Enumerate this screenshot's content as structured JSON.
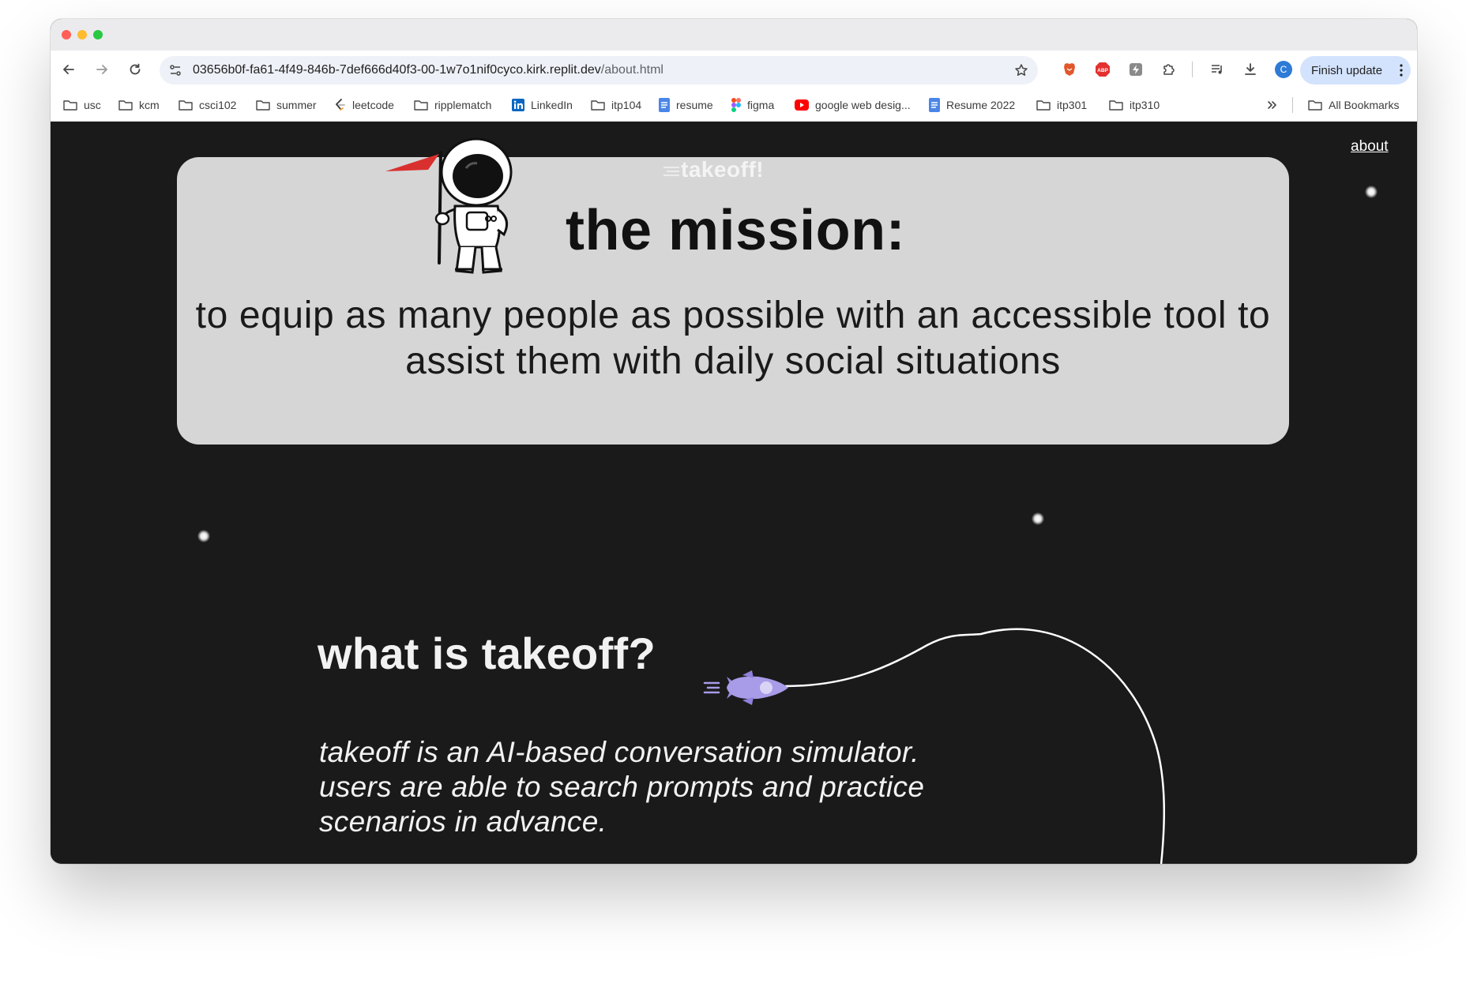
{
  "browser": {
    "url_host": "03656b0f-fa61-4f49-846b-7def666d40f3-00-1w7o1nif0cyco.kirk.replit.dev",
    "url_path": "/about.html",
    "finish_update_label": "Finish update",
    "profile_initial": "C",
    "bookmarks": [
      {
        "label": "usc",
        "icon": "folder-icon"
      },
      {
        "label": "kcm",
        "icon": "folder-icon"
      },
      {
        "label": "csci102",
        "icon": "folder-icon"
      },
      {
        "label": "summer",
        "icon": "folder-icon"
      },
      {
        "label": "leetcode",
        "icon": "leetcode-icon"
      },
      {
        "label": "ripplematch",
        "icon": "folder-icon"
      },
      {
        "label": "LinkedIn",
        "icon": "linkedin-icon"
      },
      {
        "label": "itp104",
        "icon": "folder-icon"
      },
      {
        "label": "resume",
        "icon": "docs-icon"
      },
      {
        "label": "figma",
        "icon": "figma-icon"
      },
      {
        "label": "google web desig...",
        "icon": "youtube-icon"
      },
      {
        "label": "Resume 2022",
        "icon": "docs-icon"
      },
      {
        "label": "itp301",
        "icon": "folder-icon"
      },
      {
        "label": "itp310",
        "icon": "folder-icon"
      }
    ],
    "all_bookmarks_label": "All Bookmarks"
  },
  "page": {
    "logo_text": "takeoff!",
    "nav_about": "about",
    "mission_title": "the mission:",
    "mission_text": "to equip as many people as possible with an accessible tool to assist them with daily social situations",
    "what_title": "what is takeoff?",
    "what_text": "takeoff is an AI-based conversation simulator. users are able to search prompts and practice scenarios in advance."
  },
  "colors": {
    "page_background": "#1a1a1a",
    "card_background": "#d6d6d6",
    "rocket": "#a89be8",
    "flag": "#d9302f"
  }
}
